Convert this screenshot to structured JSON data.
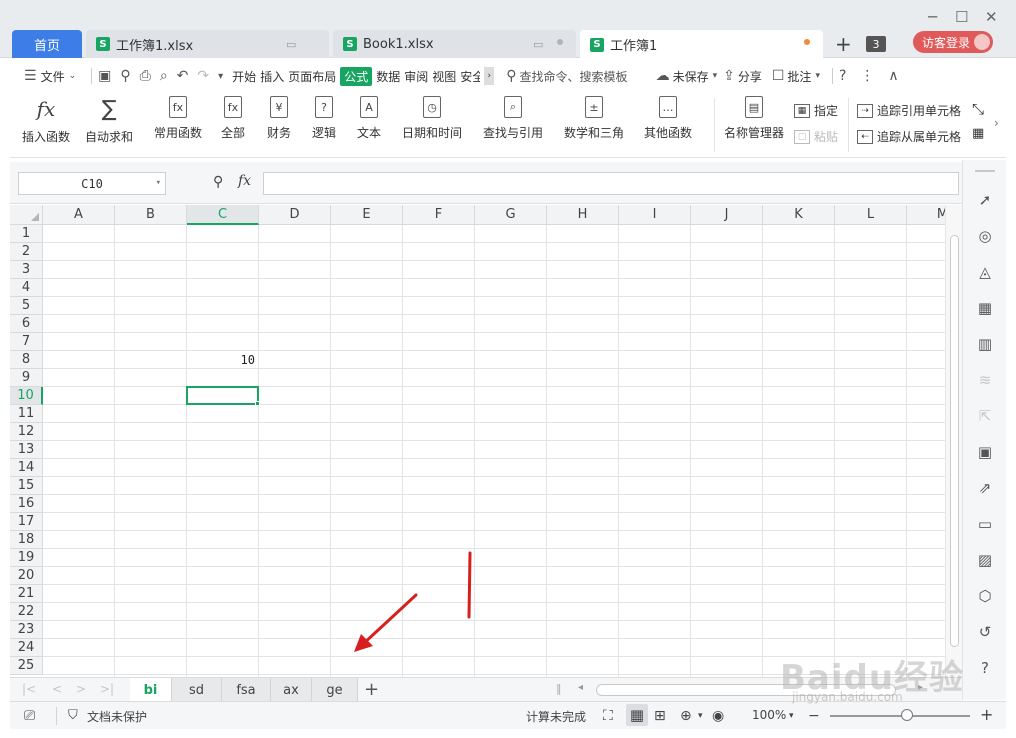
{
  "window": {
    "minimize_glyph": "─",
    "maximize_glyph": "☐",
    "close_glyph": "✕"
  },
  "tabs": {
    "home": "首页",
    "docs": [
      {
        "label": "工作簿1.xlsx"
      },
      {
        "label": "Book1.xlsx"
      },
      {
        "label": "工作簿1"
      }
    ],
    "open_count": "3",
    "login": "访客登录"
  },
  "menu": {
    "file": "文件",
    "items": [
      "开始",
      "插入",
      "页面布局",
      "公式",
      "数据",
      "审阅",
      "视图",
      "安全"
    ],
    "active": "公式",
    "search": "查找命令、搜索模板",
    "unsaved": "未保存",
    "share": "分享",
    "comment": "批注"
  },
  "ribbon": {
    "insert_function": "插入函数",
    "autosum": "自动求和",
    "common_functions": "常用函数",
    "all": "全部",
    "finance": "财务",
    "logic": "逻辑",
    "text": "文本",
    "datetime": "日期和时间",
    "lookup": "查找与引用",
    "math": "数学和三角",
    "other_functions": "其他函数",
    "name_manager": "名称管理器",
    "specify": "指定",
    "paste": "粘贴",
    "trace_precedents": "追踪引用单元格",
    "trace_dependents": "追踪从属单元格"
  },
  "formula_bar": {
    "name_box": "C10",
    "fx": "fx",
    "value": ""
  },
  "grid": {
    "columns": [
      "A",
      "B",
      "C",
      "D",
      "E",
      "F",
      "G",
      "H",
      "I",
      "J",
      "K",
      "L",
      "M"
    ],
    "rows": [
      "1",
      "2",
      "3",
      "4",
      "5",
      "6",
      "7",
      "8",
      "9",
      "10",
      "11",
      "12",
      "13",
      "14",
      "15",
      "16",
      "17",
      "18",
      "19",
      "20",
      "21",
      "22",
      "23",
      "24",
      "25"
    ],
    "selected_column": "C",
    "selected_row": "10",
    "cells": [
      {
        "ref": "C8",
        "value": "10"
      }
    ]
  },
  "sheets": {
    "tabs": [
      "bi",
      "sd",
      "fsa",
      "ax",
      "ge"
    ],
    "active": "bi",
    "add": "+"
  },
  "status": {
    "protect": "文档未保护",
    "calc": "计算未完成",
    "zoom": "100%",
    "zoom_level": 0.55
  },
  "watermark": {
    "main": "Baidu经验",
    "sub": "jingyan.baidu.com"
  },
  "colors": {
    "accent": "#17a561",
    "home_tab": "#3d7de8",
    "login": "#e05a5a",
    "annotation": "#d62020"
  }
}
